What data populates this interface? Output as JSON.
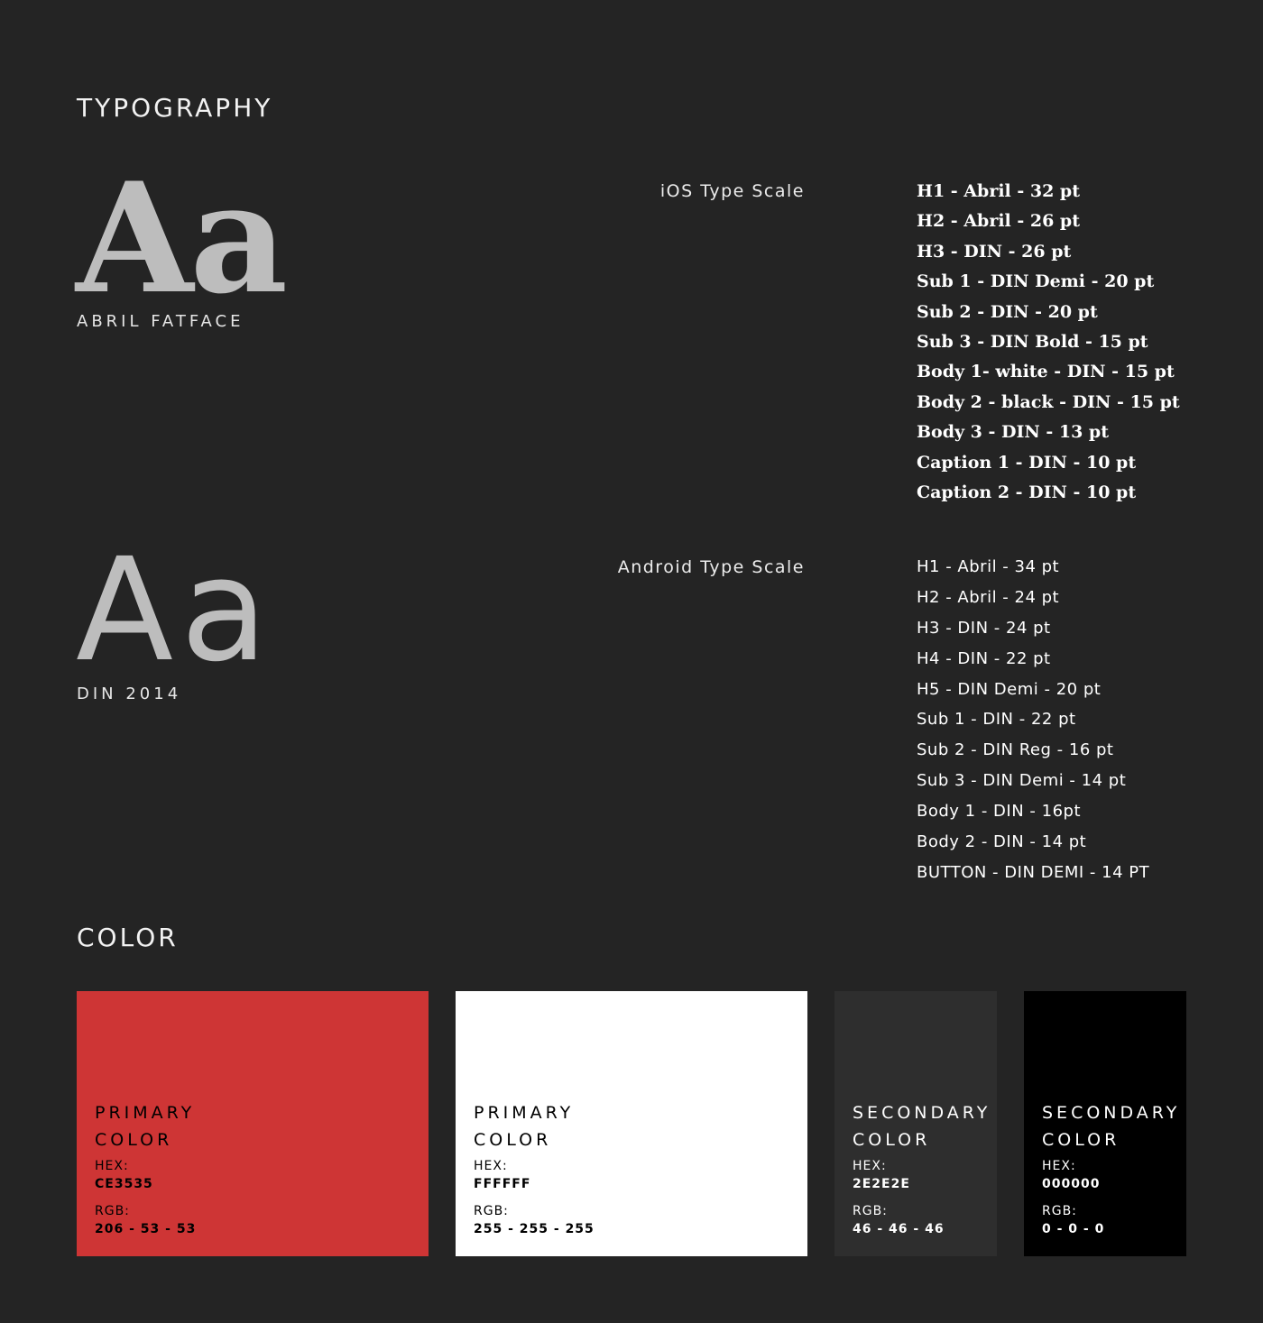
{
  "typography": {
    "title": "TYPOGRAPHY",
    "serif_specimen": {
      "glyphs": "Aa",
      "font_name": "ABRIL FATFACE"
    },
    "sans_specimen": {
      "glyphs": "Aa",
      "font_name": "DIN 2014"
    },
    "ios": {
      "label": "iOS Type Scale",
      "items": [
        "H1 - Abril - 32 pt",
        "H2 - Abril - 26 pt",
        "H3 - DIN - 26 pt",
        "Sub 1 - DIN Demi - 20 pt",
        "Sub 2 - DIN - 20 pt",
        "Sub 3 - DIN Bold - 15 pt",
        "Body 1- white - DIN - 15 pt",
        "Body 2 - black - DIN - 15 pt",
        "Body 3 - DIN - 13 pt",
        "Caption 1 - DIN - 10 pt",
        "Caption 2 - DIN - 10 pt"
      ]
    },
    "android": {
      "label": "Android Type Scale",
      "items": [
        "H1 - Abril - 34 pt",
        "H2 - Abril - 24 pt",
        "H3 - DIN - 24 pt",
        "H4 - DIN - 22 pt",
        "H5 - DIN Demi - 20 pt",
        "Sub 1 - DIN -  22 pt",
        "Sub 2 - DIN Reg - 16 pt",
        "Sub 3 - DIN Demi - 14 pt",
        "Body 1 - DIN - 16pt",
        "Body 2 - DIN - 14 pt",
        "BUTTON - DIN DEMI - 14 PT"
      ]
    }
  },
  "color": {
    "title": "COLOR",
    "hex_label": "HEX:",
    "rgb_label": "RGB:",
    "swatches": [
      {
        "name": "PRIMARY\nCOLOR",
        "hex": "CE3535",
        "rgb": "206 - 53 - 53",
        "bg": "#CE3535",
        "fg": "#000000"
      },
      {
        "name": "PRIMARY\nCOLOR",
        "hex": "FFFFFF",
        "rgb": "255 - 255 - 255",
        "bg": "#FFFFFF",
        "fg": "#000000"
      },
      {
        "name": "SECONDARY\nCOLOR",
        "hex": "2E2E2E",
        "rgb": "46 - 46 - 46",
        "bg": "#2E2E2E",
        "fg": "#FFFFFF"
      },
      {
        "name": "SECONDARY\nCOLOR",
        "hex": "000000",
        "rgb": "0 - 0 - 0",
        "bg": "#000000",
        "fg": "#FFFFFF"
      }
    ]
  }
}
